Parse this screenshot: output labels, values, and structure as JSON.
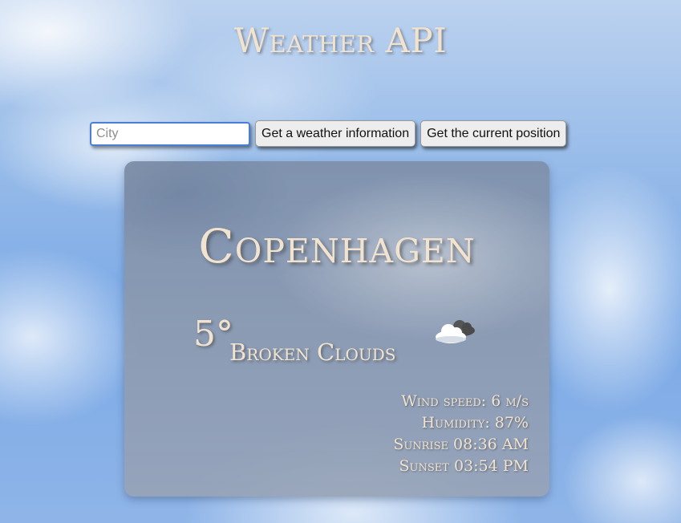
{
  "page": {
    "title": "Weather API"
  },
  "controls": {
    "city_placeholder": "City",
    "city_value": "",
    "get_weather_label": "Get a weather information",
    "get_position_label": "Get the current position"
  },
  "weather": {
    "city": "Copenhagen",
    "temperature": "5°",
    "condition": "Broken Clouds",
    "icon": "broken-clouds-icon",
    "wind_speed": "Wind speed: 6 m/s",
    "humidity": "Humidity: 87%",
    "sunrise": "Sunrise 08:36 AM",
    "sunset": "Sunset 03:54 PM"
  },
  "colors": {
    "text_accent": "#f1e3cf",
    "input_focus_border": "#4a7fd6",
    "button_background": "#ededed"
  }
}
